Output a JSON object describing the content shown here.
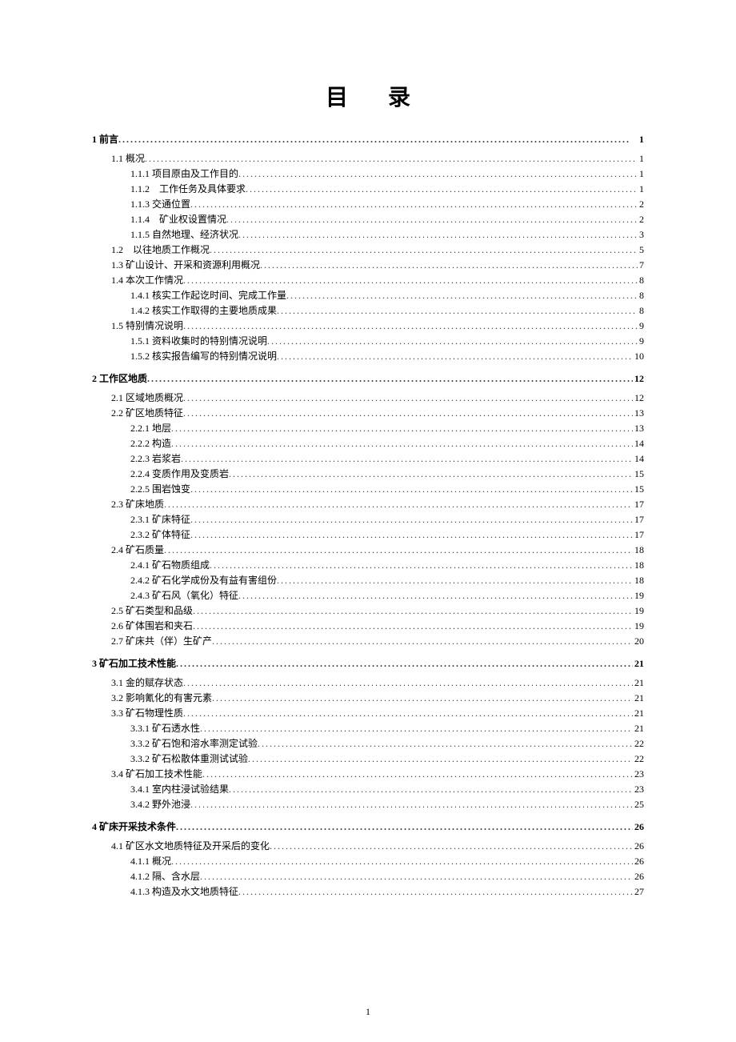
{
  "title": "目录",
  "page_number": "1",
  "toc": [
    {
      "level": 1,
      "label": "1 前言",
      "page": "1"
    },
    {
      "level": 2,
      "label": "1.1 概况",
      "page": "1"
    },
    {
      "level": 3,
      "label": "1.1.1 项目原由及工作目的",
      "page": "1"
    },
    {
      "level": 3,
      "label": "1.1.2　工作任务及具体要求",
      "page": "1"
    },
    {
      "level": 3,
      "label": "1.1.3 交通位置",
      "page": "2"
    },
    {
      "level": 3,
      "label": "1.1.4　矿业权设置情况",
      "page": "2"
    },
    {
      "level": 3,
      "label": "1.1.5 自然地理、经济状况",
      "page": "3"
    },
    {
      "level": 2,
      "label": "1.2　以往地质工作概况",
      "page": "5"
    },
    {
      "level": 2,
      "label": "1.3 矿山设计、开采和资源利用概况",
      "page": "7"
    },
    {
      "level": 2,
      "label": "1.4 本次工作情况",
      "page": "8"
    },
    {
      "level": 3,
      "label": "1.4.1 核实工作起讫时间、完成工作量",
      "page": "8"
    },
    {
      "level": 3,
      "label": "1.4.2 核实工作取得的主要地质成果",
      "page": "8"
    },
    {
      "level": 2,
      "label": "1.5 特别情况说明",
      "page": "9"
    },
    {
      "level": 3,
      "label": "1.5.1 资料收集时的特别情况说明",
      "page": "9"
    },
    {
      "level": 3,
      "label": "1.5.2 核实报告编写的特别情况说明",
      "page": "10"
    },
    {
      "level": 1,
      "label": "2 工作区地质",
      "page": "12"
    },
    {
      "level": 2,
      "label": "2.1 区域地质概况",
      "page": "12"
    },
    {
      "level": 2,
      "label": "2.2 矿区地质特征",
      "page": "13"
    },
    {
      "level": 3,
      "label": "2.2.1 地层",
      "page": "13"
    },
    {
      "level": 3,
      "label": "2.2.2 构造",
      "page": "14"
    },
    {
      "level": 3,
      "label": "2.2.3 岩浆岩",
      "page": "14"
    },
    {
      "level": 3,
      "label": "2.2.4 变质作用及变质岩",
      "page": "15"
    },
    {
      "level": 3,
      "label": "2.2.5 围岩蚀变",
      "page": "15"
    },
    {
      "level": 2,
      "label": "2.3 矿床地质",
      "page": "17"
    },
    {
      "level": 3,
      "label": "2.3.1 矿床特征",
      "page": "17"
    },
    {
      "level": 3,
      "label": "2.3.2 矿体特征",
      "page": "17"
    },
    {
      "level": 2,
      "label": "2.4 矿石质量",
      "page": "18"
    },
    {
      "level": 3,
      "label": "2.4.1 矿石物质组成",
      "page": "18"
    },
    {
      "level": 3,
      "label": "2.4.2 矿石化学成份及有益有害组份",
      "page": "18"
    },
    {
      "level": 3,
      "label": "2.4.3 矿石风（氧化）特征",
      "page": "19"
    },
    {
      "level": 2,
      "label": "2.5 矿石类型和品级",
      "page": "19"
    },
    {
      "level": 2,
      "label": "2.6 矿体围岩和夹石",
      "page": "19"
    },
    {
      "level": 2,
      "label": "2.7 矿床共（伴）生矿产",
      "page": "20"
    },
    {
      "level": 1,
      "label": "3 矿石加工技术性能",
      "page": "21"
    },
    {
      "level": 2,
      "label": "3.1 金的赋存状态",
      "page": "21"
    },
    {
      "level": 2,
      "label": "3.2 影响氰化的有害元素",
      "page": "21"
    },
    {
      "level": 2,
      "label": "3.3 矿石物理性质",
      "page": "21"
    },
    {
      "level": 3,
      "label": "3.3.1 矿石透水性",
      "page": "21"
    },
    {
      "level": 3,
      "label": "3.3.2 矿石饱和溶水率测定试验",
      "page": "22"
    },
    {
      "level": 3,
      "label": "3.3.2 矿石松散体重测试试验",
      "page": "22"
    },
    {
      "level": 2,
      "label": "3.4 矿石加工技术性能",
      "page": "23"
    },
    {
      "level": 3,
      "label": "3.4.1 室内柱浸试验结果",
      "page": "23"
    },
    {
      "level": 3,
      "label": "3.4.2 野外池浸",
      "page": "25"
    },
    {
      "level": 1,
      "label": "4 矿床开采技术条件",
      "page": "26"
    },
    {
      "level": 2,
      "label": "4.1 矿区水文地质特征及开采后的变化",
      "page": "26"
    },
    {
      "level": 3,
      "label": "4.1.1 概况",
      "page": "26"
    },
    {
      "level": 3,
      "label": "4.1.2 隔、含水层",
      "page": "26"
    },
    {
      "level": 3,
      "label": "4.1.3 构造及水文地质特征",
      "page": "27"
    }
  ]
}
